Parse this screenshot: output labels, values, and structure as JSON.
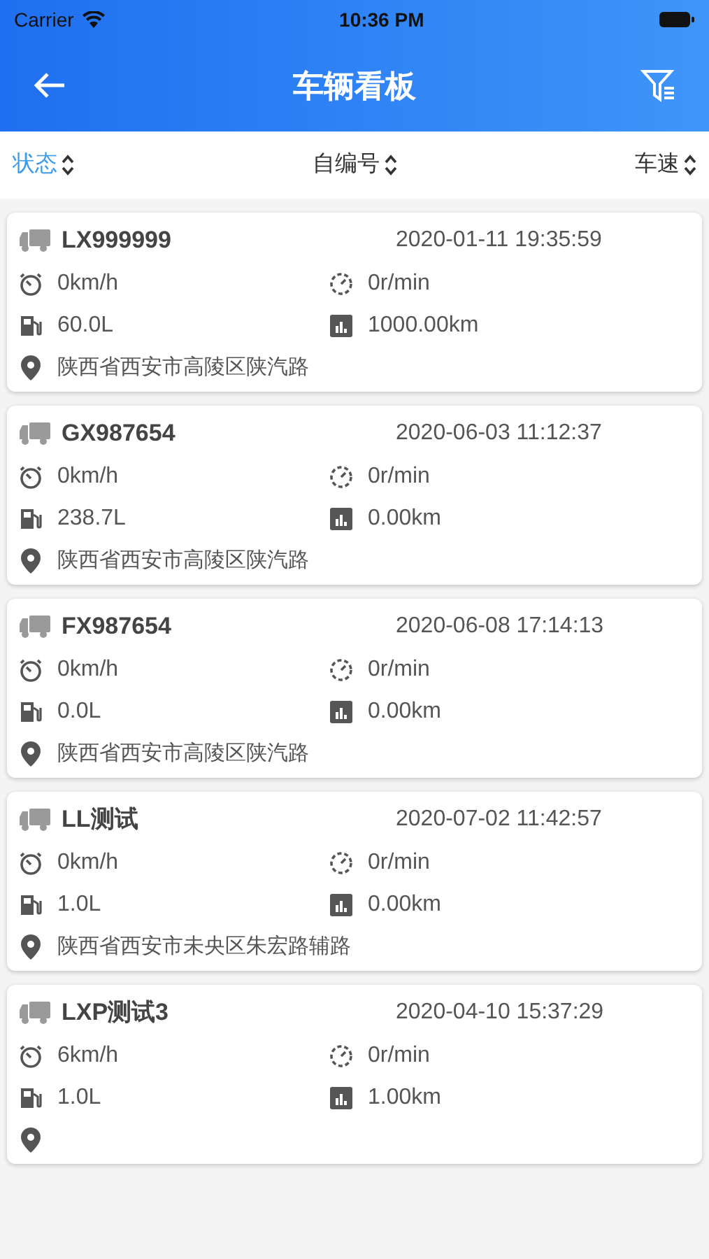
{
  "status_bar": {
    "carrier": "Carrier",
    "time": "10:36 PM"
  },
  "nav": {
    "title": "车辆看板"
  },
  "sort_tabs": [
    {
      "label": "状态",
      "selected": true
    },
    {
      "label": "自编号",
      "selected": false
    },
    {
      "label": "车速",
      "selected": false
    }
  ],
  "vehicles": [
    {
      "id": "LX999999",
      "time": "2020-01-11 19:35:59",
      "speed": "0km/h",
      "rpm": "0r/min",
      "fuel": "60.0L",
      "mileage": "1000.00km",
      "address": "陕西省西安市高陵区陕汽路"
    },
    {
      "id": "GX987654",
      "time": "2020-06-03 11:12:37",
      "speed": "0km/h",
      "rpm": "0r/min",
      "fuel": "238.7L",
      "mileage": "0.00km",
      "address": "陕西省西安市高陵区陕汽路"
    },
    {
      "id": "FX987654",
      "time": "2020-06-08 17:14:13",
      "speed": "0km/h",
      "rpm": "0r/min",
      "fuel": "0.0L",
      "mileage": "0.00km",
      "address": "陕西省西安市高陵区陕汽路"
    },
    {
      "id": "LL测试",
      "time": "2020-07-02 11:42:57",
      "speed": "0km/h",
      "rpm": "0r/min",
      "fuel": "1.0L",
      "mileage": "0.00km",
      "address": "陕西省西安市未央区朱宏路辅路"
    },
    {
      "id": "LXP测试3",
      "time": "2020-04-10 15:37:29",
      "speed": "6km/h",
      "rpm": "0r/min",
      "fuel": "1.0L",
      "mileage": "1.00km"
    }
  ]
}
